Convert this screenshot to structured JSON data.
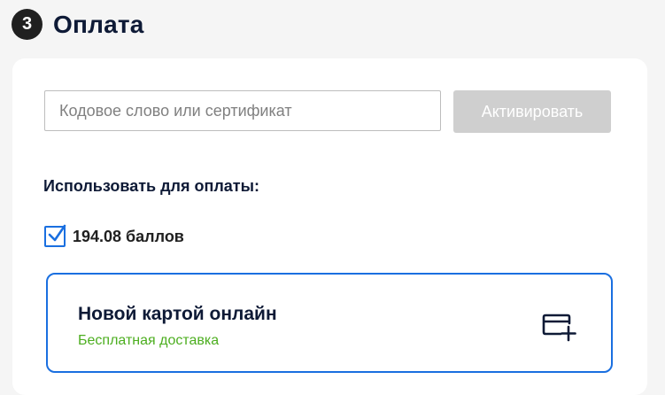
{
  "section": {
    "step_number": "3",
    "title": "Оплата"
  },
  "promo": {
    "placeholder": "Кодовое слово или сертификат",
    "value": "",
    "activate_label": "Активировать"
  },
  "payment": {
    "use_for_payment_label": "Использовать для оплаты:",
    "points": {
      "label": "194.08 баллов",
      "checked": true
    },
    "options": [
      {
        "title": "Новой картой онлайн",
        "subtitle": "Бесплатная доставка",
        "icon": "add-card-icon",
        "selected": true
      }
    ]
  },
  "colors": {
    "accent": "#1a6fe0",
    "success_text": "#4cae1f",
    "disabled_button": "#cfcfcf",
    "heading": "#0e1a36"
  }
}
